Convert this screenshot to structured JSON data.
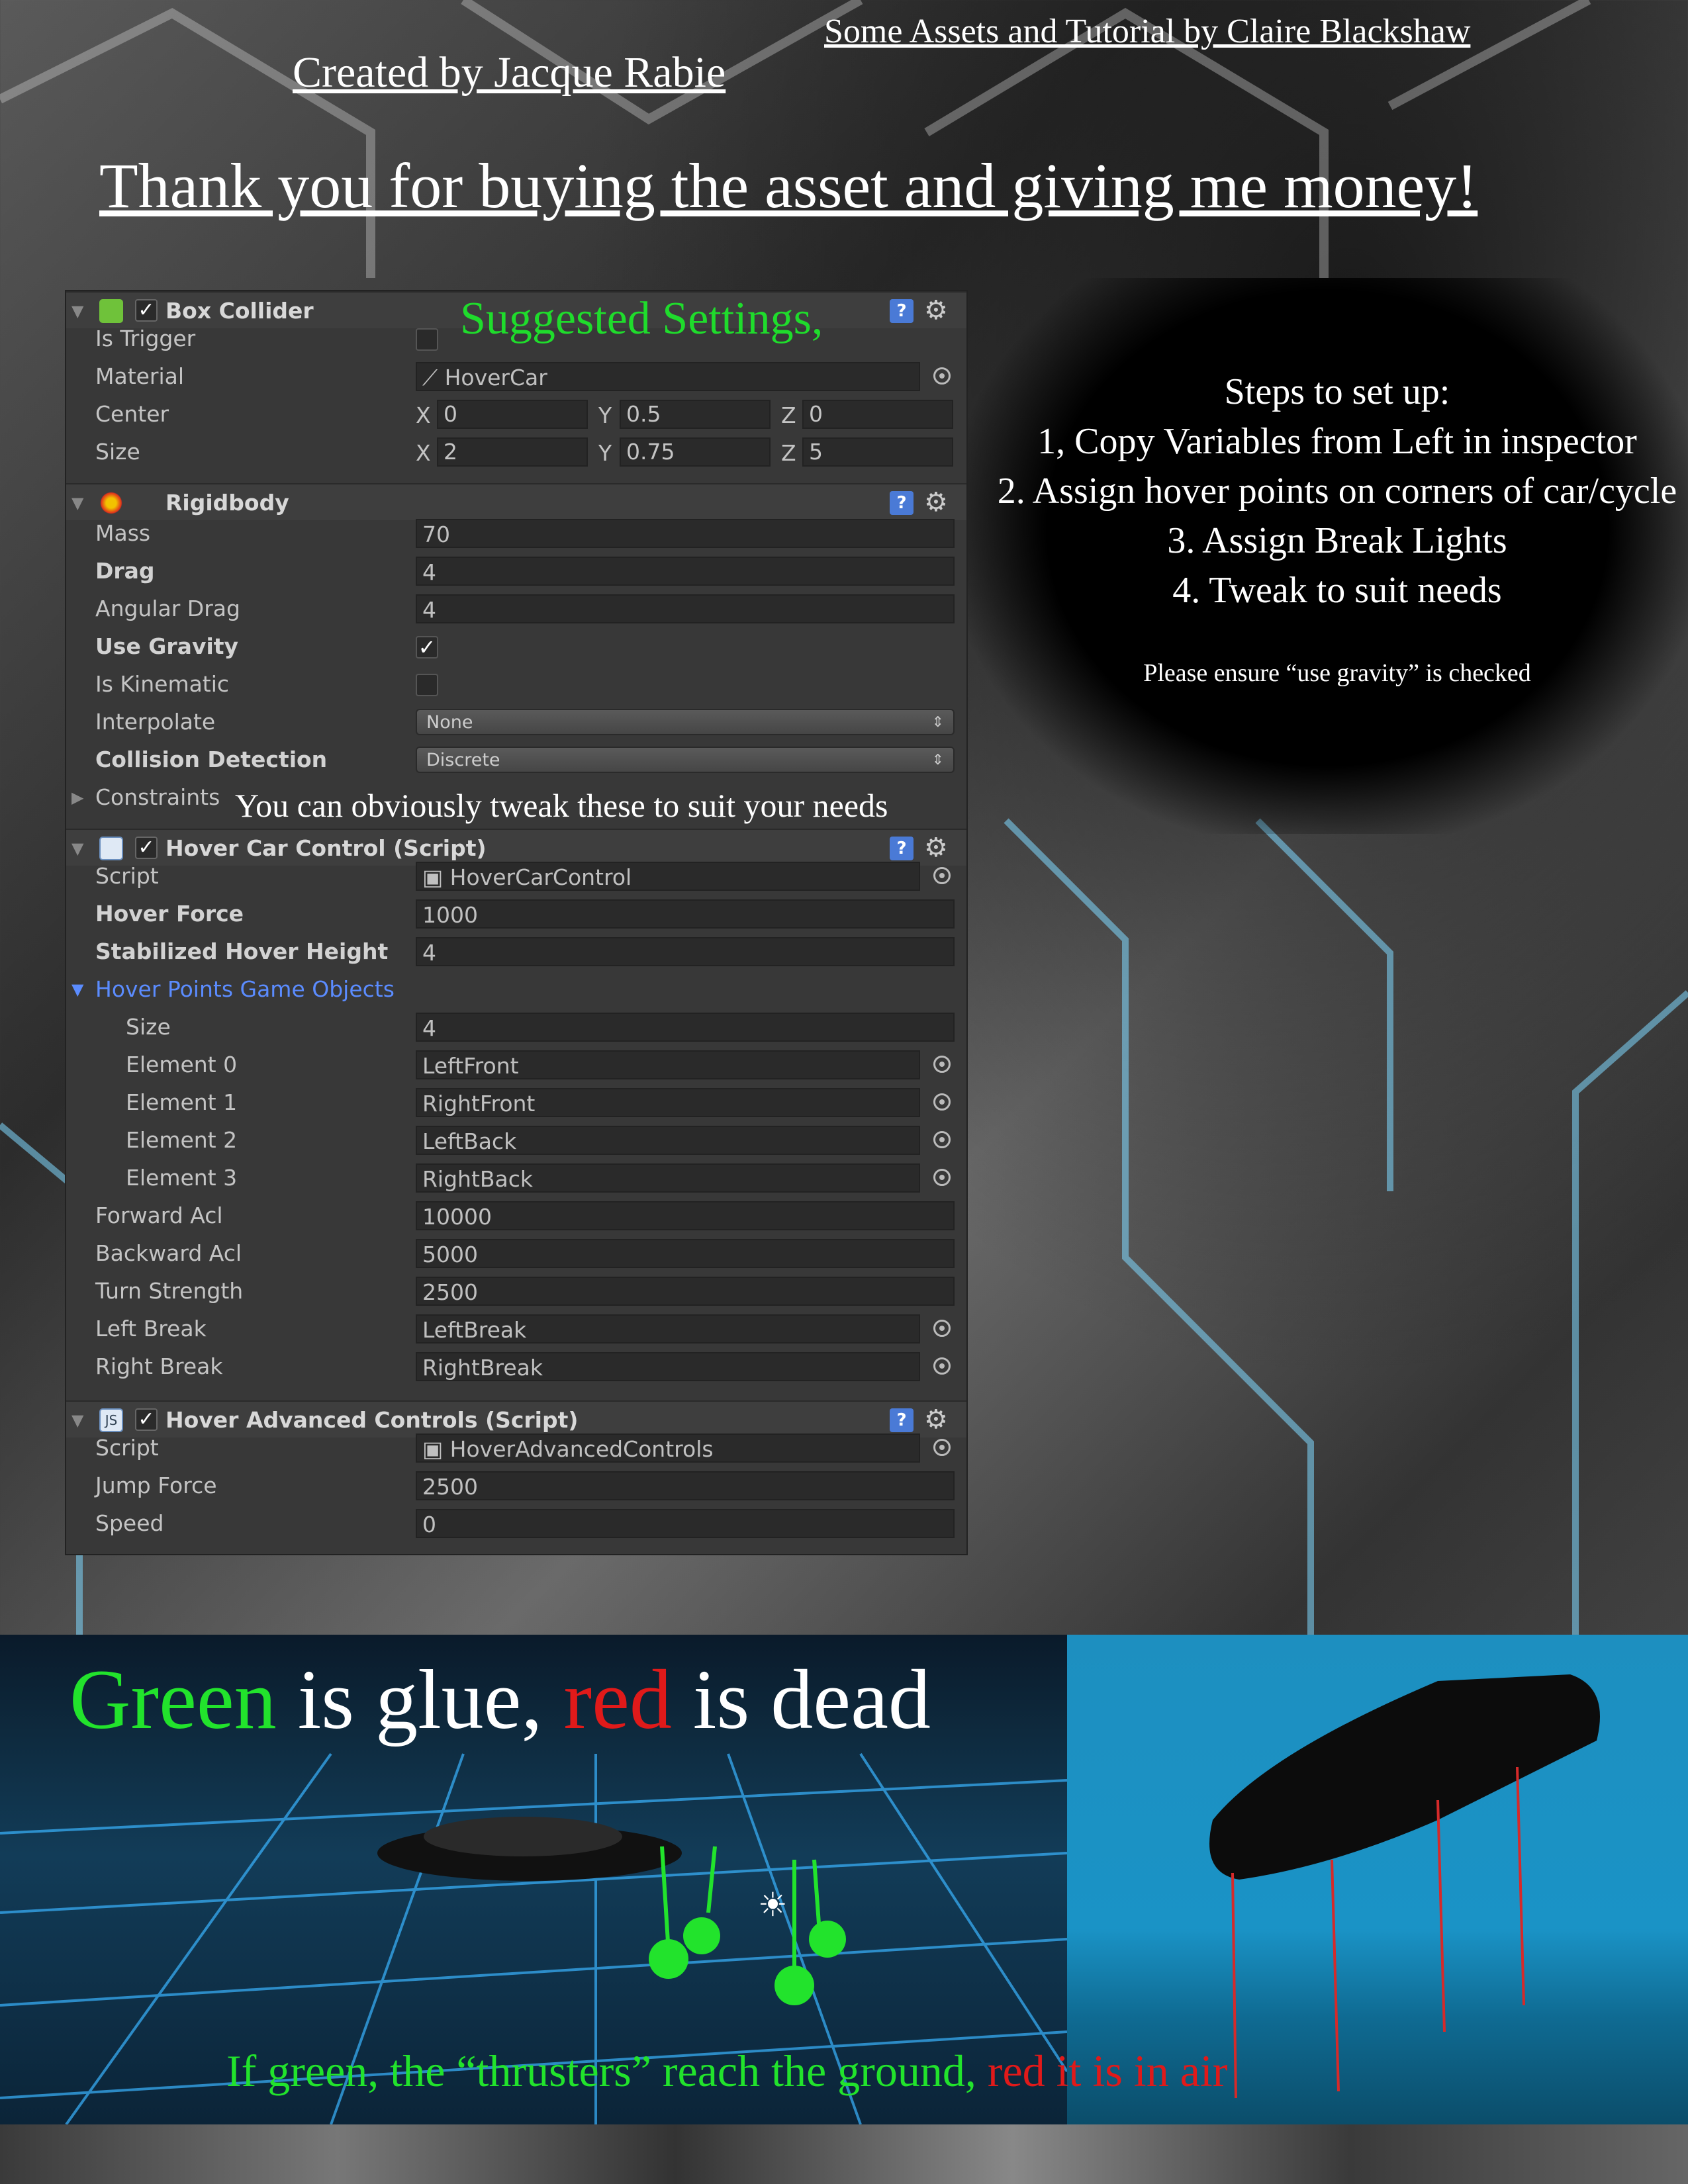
{
  "header": {
    "credit_assets": "Some Assets and Tutorial by Claire Blackshaw",
    "credit_created": "Created by Jacque Rabie",
    "thanks": "Thank you for buying the asset and giving me money!"
  },
  "annotations": {
    "suggested": "Suggested Settings,",
    "tweak": "You can obviously tweak these to suit your needs"
  },
  "steps": {
    "title": "Steps to set up:",
    "items": [
      "1, Copy Variables from Left in inspector",
      "2. Assign hover points on corners of car/cycle",
      "3. Assign Break Lights",
      "4. Tweak to suit needs"
    ],
    "note": "Please ensure “use gravity” is checked"
  },
  "inspector": {
    "box_collider": {
      "title": "Box Collider",
      "enabled": true,
      "is_trigger_label": "Is Trigger",
      "is_trigger": false,
      "material_label": "Material",
      "material": "HoverCar",
      "center_label": "Center",
      "center": {
        "x": "0",
        "y": "0.5",
        "z": "0"
      },
      "size_label": "Size",
      "size": {
        "x": "2",
        "y": "0.75",
        "z": "5"
      },
      "axis_x": "X",
      "axis_y": "Y",
      "axis_z": "Z"
    },
    "rigidbody": {
      "title": "Rigidbody",
      "mass_label": "Mass",
      "mass": "70",
      "drag_label": "Drag",
      "drag": "4",
      "angular_drag_label": "Angular Drag",
      "angular_drag": "4",
      "use_gravity_label": "Use Gravity",
      "use_gravity": true,
      "is_kinematic_label": "Is Kinematic",
      "is_kinematic": false,
      "interpolate_label": "Interpolate",
      "interpolate": "None",
      "collision_label": "Collision Detection",
      "collision": "Discrete",
      "constraints_label": "Constraints"
    },
    "hover_car_control": {
      "title": "Hover Car Control (Script)",
      "enabled": true,
      "script_label": "Script",
      "script": "HoverCarControl",
      "hover_force_label": "Hover Force",
      "hover_force": "1000",
      "stab_height_label": "Stabilized Hover Height",
      "stab_height": "4",
      "hover_points_label": "Hover Points Game Objects",
      "size_label": "Size",
      "size": "4",
      "elements": [
        {
          "label": "Element 0",
          "value": "LeftFront"
        },
        {
          "label": "Element 1",
          "value": "RightFront"
        },
        {
          "label": "Element 2",
          "value": "LeftBack"
        },
        {
          "label": "Element 3",
          "value": "RightBack"
        }
      ],
      "forward_label": "Forward Acl",
      "forward": "10000",
      "backward_label": "Backward Acl",
      "backward": "5000",
      "turn_label": "Turn Strength",
      "turn": "2500",
      "left_break_label": "Left Break",
      "left_break": "LeftBreak",
      "right_break_label": "Right Break",
      "right_break": "RightBreak"
    },
    "hover_advanced": {
      "title": "Hover Advanced Controls (Script)",
      "enabled": true,
      "script_label": "Script",
      "script": "HoverAdvancedControls",
      "jump_label": "Jump Force",
      "jump": "2500",
      "speed_label": "Speed",
      "speed": "0"
    },
    "help_glyph": "?",
    "gear_glyph": "⚙"
  },
  "scene": {
    "glue_green": "Green",
    "glue_mid": " is glue, ",
    "glue_red": "red",
    "glue_end": " is dead",
    "if_green": "If green, the “thrusters” reach the ground, ",
    "if_red": "red it is in air"
  },
  "colors": {
    "accent_green": "#22e32c",
    "accent_red": "#e01a1a",
    "link_blue": "#5b8cff"
  }
}
